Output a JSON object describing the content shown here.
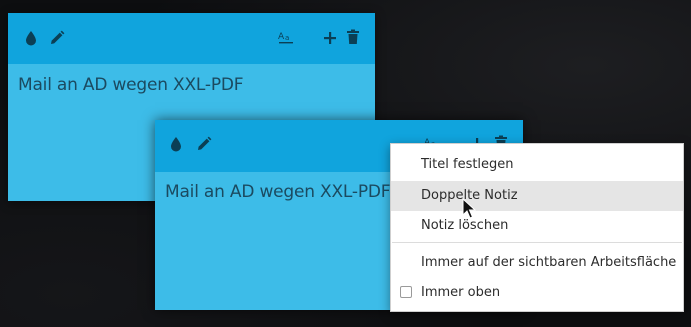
{
  "notes": [
    {
      "text": "Mail an AD wegen XXL-PDF",
      "header_color": "#10a4dd",
      "body_color": "#3dbce8",
      "toolbar": [
        "color-drop-icon",
        "edit-pencil-icon",
        "font-size-icon",
        "add-note-icon",
        "delete-trash-icon"
      ]
    },
    {
      "text": "Mail an AD wegen XXL-PDF",
      "header_color": "#10a4dd",
      "body_color": "#3dbce8",
      "toolbar": [
        "color-drop-icon",
        "edit-pencil-icon",
        "font-size-icon",
        "add-note-icon",
        "delete-trash-icon"
      ]
    }
  ],
  "context_menu": {
    "items": [
      {
        "label": "Titel festlegen"
      },
      {
        "label": "Doppelte Notiz",
        "hovered": true
      },
      {
        "label": "Notiz löschen"
      },
      {
        "label": "Immer auf der sichtbaren Arbeitsfläche"
      },
      {
        "label": "Immer oben",
        "checkbox": true,
        "checked": false
      }
    ]
  }
}
